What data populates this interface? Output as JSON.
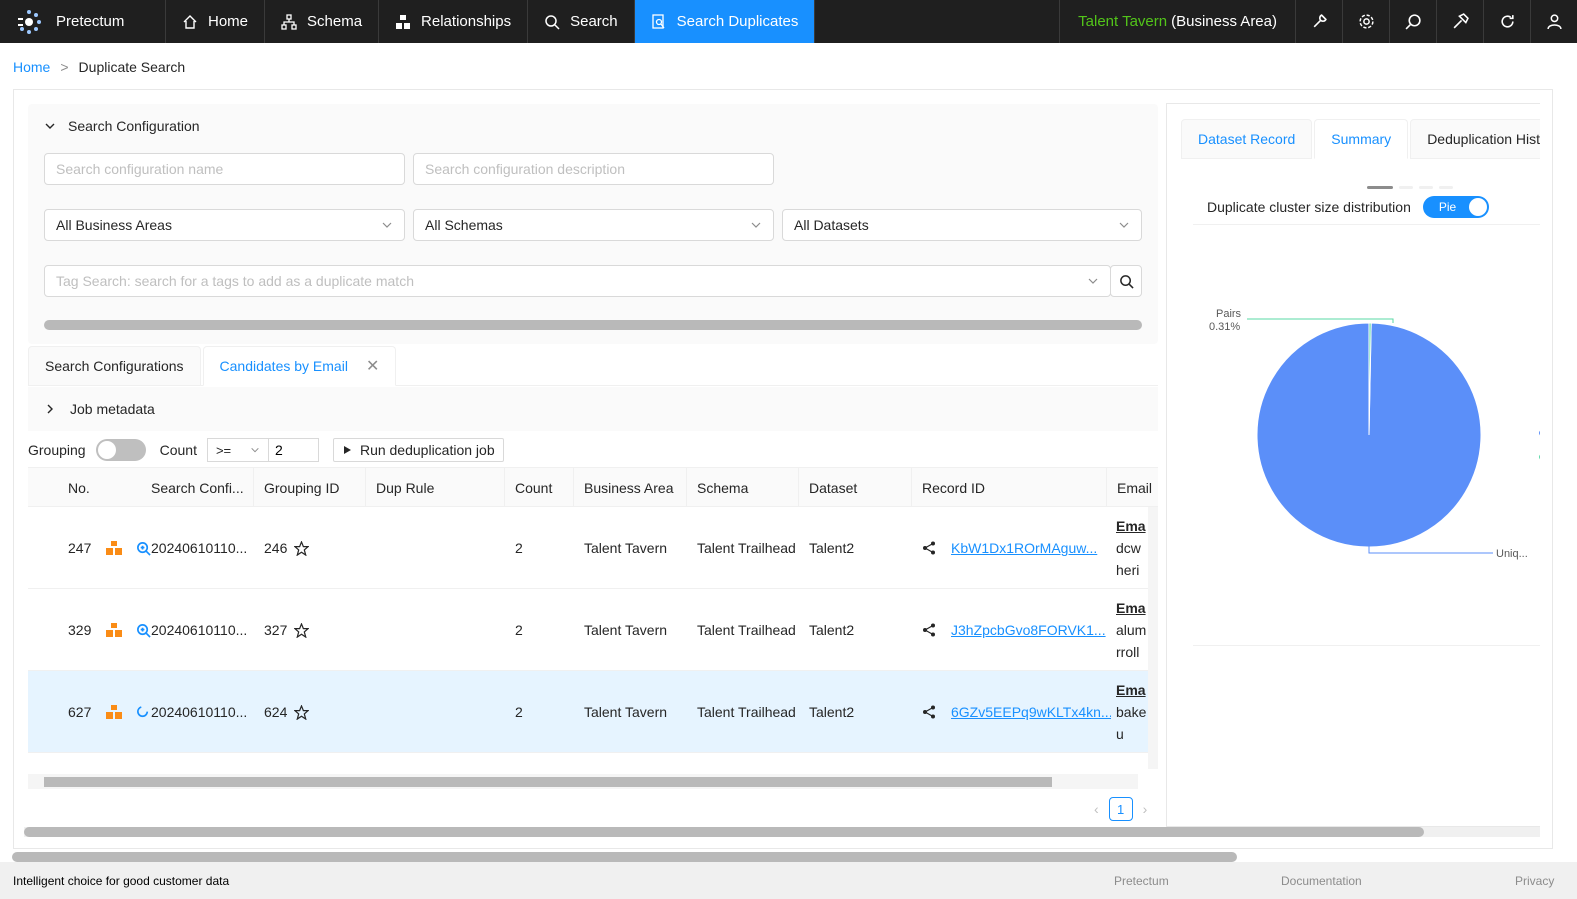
{
  "nav": {
    "brand": "Pretectum",
    "items": [
      {
        "label": "Home",
        "icon": "home-icon"
      },
      {
        "label": "Schema",
        "icon": "schema-icon"
      },
      {
        "label": "Relationships",
        "icon": "relationships-icon"
      },
      {
        "label": "Search",
        "icon": "search-icon"
      },
      {
        "label": "Search Duplicates",
        "icon": "search-duplicates-icon",
        "active": true
      }
    ],
    "business_area": "Talent Tavern",
    "business_area_suffix": "(Business Area)"
  },
  "breadcrumb": {
    "home": "Home",
    "separator": ">",
    "current": "Duplicate Search"
  },
  "config": {
    "title": "Search Configuration",
    "name_placeholder": "Search configuration name",
    "desc_placeholder": "Search configuration description",
    "business_areas": "All Business Areas",
    "schemas": "All Schemas",
    "datasets": "All Datasets",
    "tag_placeholder": "Tag Search: search for a tags to add as a duplicate match"
  },
  "tabs": {
    "configs": "Search Configurations",
    "candidates": "Candidates by Email",
    "close": "✕"
  },
  "job_metadata": "Job metadata",
  "controls": {
    "grouping": "Grouping",
    "count": "Count",
    "operator": ">=",
    "count_value": "2",
    "run": "Run deduplication job"
  },
  "table": {
    "headers": [
      "No.",
      "Search Confi...",
      "Grouping ID",
      "Dup Rule",
      "Count",
      "Business Area",
      "Schema",
      "Dataset",
      "Record ID",
      "Email"
    ],
    "rows": [
      {
        "no": "247",
        "config": "20240610110...",
        "group": "246",
        "count": "2",
        "area": "Talent Tavern",
        "schema": "Talent Trailhead",
        "dataset": "Talent2",
        "record": "KbW1Dx1ROrMAguw...",
        "email1": "Ema",
        "email2": "dcw",
        "email3": "heri"
      },
      {
        "no": "329",
        "config": "20240610110...",
        "group": "327",
        "count": "2",
        "area": "Talent Tavern",
        "schema": "Talent Trailhead",
        "dataset": "Talent2",
        "record": "J3hZpcbGvo8FORVK1...",
        "email1": "Ema",
        "email2": "alum",
        "email3": "rroll"
      },
      {
        "no": "627",
        "config": "20240610110...",
        "group": "624",
        "count": "2",
        "area": "Talent Tavern",
        "schema": "Talent Trailhead",
        "dataset": "Talent2",
        "record": "6GZv5EEPq9wKLTx4kn...",
        "email1": "Ema",
        "email2": "bake",
        "email3": "u"
      }
    ]
  },
  "pager": {
    "page": "1"
  },
  "right": {
    "tabs": [
      "Dataset Record",
      "Summary",
      "Deduplication Histo"
    ],
    "dist_label": "Duplicate cluster size distribution",
    "switch_label": "Pie",
    "pairs_label": "Pairs",
    "pairs_pct": "0.31%",
    "unique_label": "Uniq...",
    "colors": {
      "pie": "#5b8ff9",
      "accent": "#1890ff",
      "green": "#5ad8a6"
    }
  },
  "chart_data": {
    "type": "pie",
    "title": "",
    "categories": [
      "Uniq...",
      "Pairs"
    ],
    "values": [
      99.69,
      0.31
    ]
  },
  "footer": {
    "tagline": "Intelligent choice for good customer data",
    "links": [
      "Pretectum",
      "Documentation",
      "Privacy"
    ]
  }
}
